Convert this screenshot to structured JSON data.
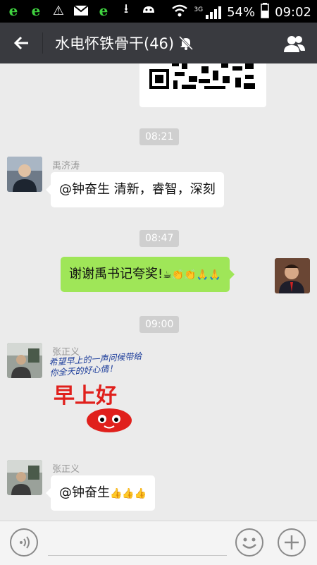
{
  "status_bar": {
    "battery": "54%",
    "time": "09:02",
    "network": "3G"
  },
  "app_bar": {
    "title": "水电怀铁骨干(46)"
  },
  "messages": {
    "t1": "08:21",
    "m1_sender": "禹济涛",
    "m1_text": "@钟奋生 清新，睿智，深刻",
    "t2": "08:47",
    "m2_text": "谢谢禹书记夸奖!",
    "m2_emoji": "☕👏👏🙏🙏",
    "t3": "09:00",
    "m3_sender": "张正义",
    "m3_sticker_text": "希望早上的一声问候带给你全天的好心情！",
    "m3_sticker_title": "早上好",
    "m4_sender": "张正义",
    "m4_text": "@钟奋生",
    "m4_emoji": "👍👍👍"
  },
  "colors": {
    "appbar": "#393a3f",
    "sent_bubble": "#9fe658",
    "background": "#ebebeb"
  }
}
